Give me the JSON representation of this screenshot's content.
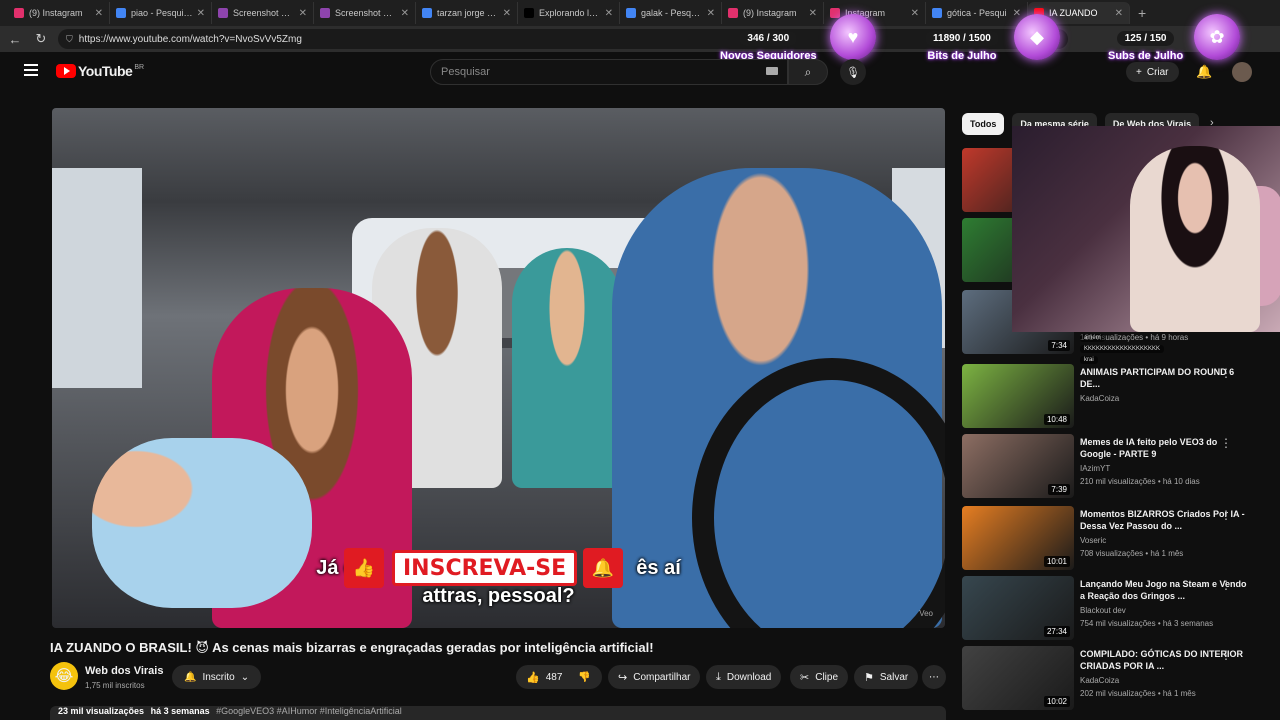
{
  "tabs": [
    {
      "label": "(9) Instagram",
      "color": "#e1306c"
    },
    {
      "label": "piao - Pesquisa G",
      "color": "#4285f4"
    },
    {
      "label": "Screenshot por L",
      "color": "#8e44ad"
    },
    {
      "label": "Screenshot por L",
      "color": "#8e44ad"
    },
    {
      "label": "tarzan jorge - Pe",
      "color": "#4285f4"
    },
    {
      "label": "Explorando la Be",
      "color": "#000000"
    },
    {
      "label": "galak - Pesquisa",
      "color": "#4285f4"
    },
    {
      "label": "(9) Instagram",
      "color": "#e1306c"
    },
    {
      "label": "Instagram",
      "color": "#e1306c"
    },
    {
      "label": "gótica - Pesqui",
      "color": "#4285f4"
    },
    {
      "label": "IA ZUANDO",
      "color": "#ff0000"
    }
  ],
  "url": "https://www.youtube.com/watch?v=NvoSvVv5Zmg",
  "overlay": {
    "followers": {
      "count": "346 / 300",
      "label": "Novos Seguidores"
    },
    "bits": {
      "count": "11890 / 1500",
      "label": "Bits de Julho"
    },
    "subs": {
      "count": "125 / 150",
      "label": "Subs de Julho"
    }
  },
  "header": {
    "logo": "YouTube",
    "country": "BR",
    "search_placeholder": "Pesquisar",
    "create": "Criar"
  },
  "video": {
    "subtitle_line1": "Já o",
    "subtitle_line1_end": "ês aí",
    "subtitle_line2": "attras, pessoal?",
    "cta": "INSCREVA-SE",
    "watermark": "Veo"
  },
  "title": "IA ZUANDO O BRASIL! 😈 As cenas mais bizarras e engraçadas geradas por inteligência artificial!",
  "channel": {
    "name": "Web dos Virais",
    "subs": "1,75 mil inscritos",
    "subscribed": "Inscrito"
  },
  "actions": {
    "likes": "487",
    "share": "Compartilhar",
    "download": "Download",
    "clip": "Clipe",
    "save": "Salvar"
  },
  "description": {
    "views": "23 mil visualizações",
    "age": "há 3 semanas",
    "tags": "#GoogleVEO3 #AIHumor #InteligênciaArtificial"
  },
  "chips": [
    "Todos",
    "Da mesma série",
    "De Web dos Virais"
  ],
  "recommendations": [
    {
      "title": "",
      "channel": "",
      "meta": "",
      "duration": ""
    },
    {
      "title": "",
      "channel": "",
      "meta": "",
      "duration": ""
    },
    {
      "title": "",
      "channel": "",
      "meta": "161 visualizações • há 9 horas",
      "duration": "7:34"
    },
    {
      "title": "ANIMAIS PARTICIPAM DO ROUND 6 DE...",
      "channel": "KadaCoiza",
      "meta": "",
      "duration": "10:48"
    },
    {
      "title": "Memes de IA feito pelo VEO3 do Google - PARTE 9",
      "channel": "IAzimYT",
      "meta": "210 mil visualizações • há 10 dias",
      "duration": "7:39"
    },
    {
      "title": "Momentos BIZARROS Criados Por IA - Dessa Vez Passou do ...",
      "channel": "Voseric",
      "meta": "708 visualizações • há 1 mês",
      "duration": "10:01"
    },
    {
      "title": "Lançando Meu Jogo na Steam e Vendo a Reação dos Gringos ...",
      "channel": "Blackout dev",
      "meta": "754 mil visualizações • há 3 semanas",
      "duration": "27:34"
    },
    {
      "title": "COMPILADO: GÓTICAS DO INTERIOR CRIADAS POR IA ...",
      "channel": "KadaCoiza",
      "meta": "202 mil visualizações • há 1 mês",
      "duration": "10:02"
    }
  ],
  "chat": [
    "amém",
    "KKKKKKKKKKKKKKKKKKK",
    "krai"
  ],
  "colors": {
    "accent": "#ff0000",
    "cta": "#e01b22",
    "overlay_glow": "#b040ff"
  }
}
